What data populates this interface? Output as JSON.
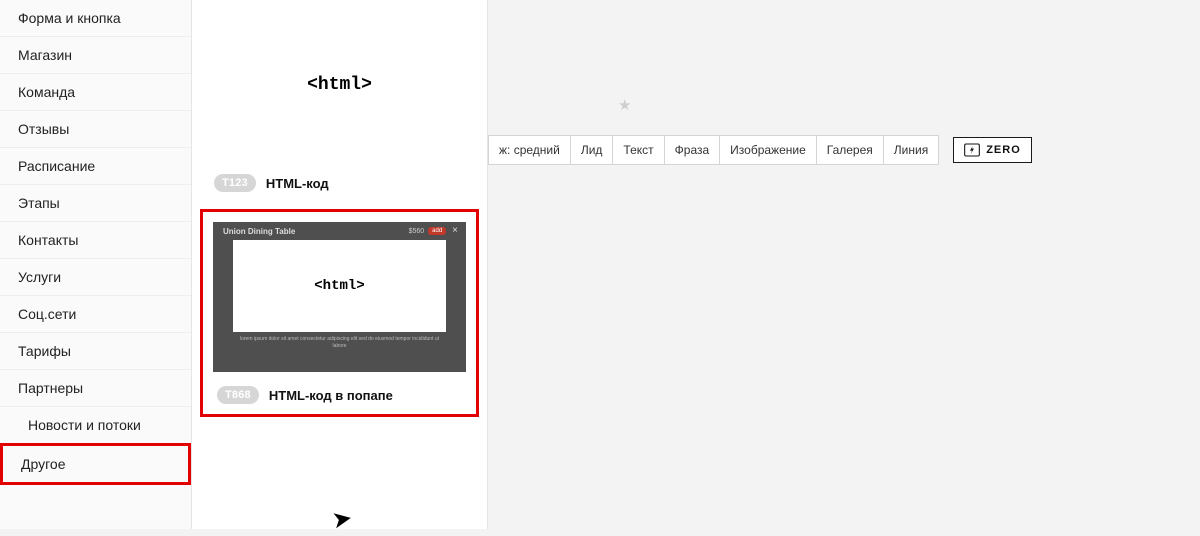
{
  "sidebar": {
    "items": [
      {
        "label": "Форма и кнопка"
      },
      {
        "label": "Магазин"
      },
      {
        "label": "Команда"
      },
      {
        "label": "Отзывы"
      },
      {
        "label": "Расписание"
      },
      {
        "label": "Этапы"
      },
      {
        "label": "Контакты"
      },
      {
        "label": "Услуги"
      },
      {
        "label": "Соц.сети"
      },
      {
        "label": "Тарифы"
      },
      {
        "label": "Партнеры"
      },
      {
        "label": "Новости и потоки"
      },
      {
        "label": "Другое"
      }
    ]
  },
  "blocks": {
    "html_tag": "<html>",
    "card1": {
      "code": "T123",
      "title": "HTML-код"
    },
    "card2": {
      "code": "T868",
      "title": "HTML-код в попапе",
      "popup_header": "Union Dining Table",
      "popup_price": "$560",
      "popup_btn": "add",
      "popup_footer": "lorem ipsum dolor sit amet consectetur adipiscing elit sed do eiusmod tempor incididunt ut labore"
    }
  },
  "toolbar": {
    "buttons": [
      "ж: средний",
      "Лид",
      "Текст",
      "Фраза",
      "Изображение",
      "Галерея",
      "Линия"
    ],
    "zero": "ZERO"
  }
}
